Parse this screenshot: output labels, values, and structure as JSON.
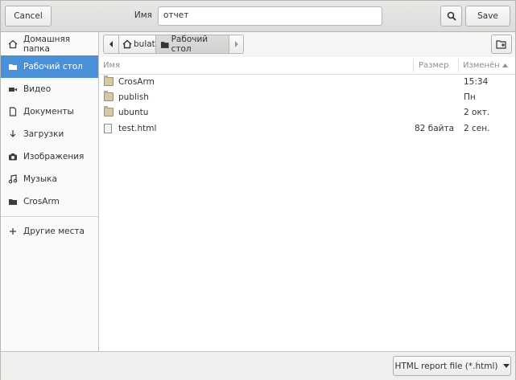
{
  "header": {
    "cancel_label": "Cancel",
    "name_label": "Имя",
    "name_value": "отчет",
    "save_label": "Save"
  },
  "sidebar": {
    "items": [
      {
        "label": "Домашняя папка",
        "icon": "home-icon"
      },
      {
        "label": "Рабочий стол",
        "icon": "folder-icon",
        "active": true
      },
      {
        "label": "Видео",
        "icon": "video-icon"
      },
      {
        "label": "Документы",
        "icon": "document-icon"
      },
      {
        "label": "Загрузки",
        "icon": "download-icon"
      },
      {
        "label": "Изображения",
        "icon": "camera-icon"
      },
      {
        "label": "Музыка",
        "icon": "music-icon"
      },
      {
        "label": "CrosArm",
        "icon": "folder-icon"
      }
    ],
    "other_places": "Другие места"
  },
  "pathbar": {
    "segments": [
      "bulat",
      "Рабочий стол"
    ]
  },
  "columns": {
    "name": "Имя",
    "size": "Размер",
    "modified": "Изменён"
  },
  "files": [
    {
      "name": "CrosArm",
      "size": "",
      "modified": "15:34",
      "type": "folder"
    },
    {
      "name": "publish",
      "size": "",
      "modified": "Пн",
      "type": "folder"
    },
    {
      "name": "ubuntu",
      "size": "",
      "modified": "2 окт.",
      "type": "folder"
    },
    {
      "name": "test.html",
      "size": "82 байта",
      "modified": "2 сен.",
      "type": "file"
    }
  ],
  "filter": {
    "selected": "HTML report file (*.html)"
  },
  "colors": {
    "accent": "#4a90d9"
  }
}
